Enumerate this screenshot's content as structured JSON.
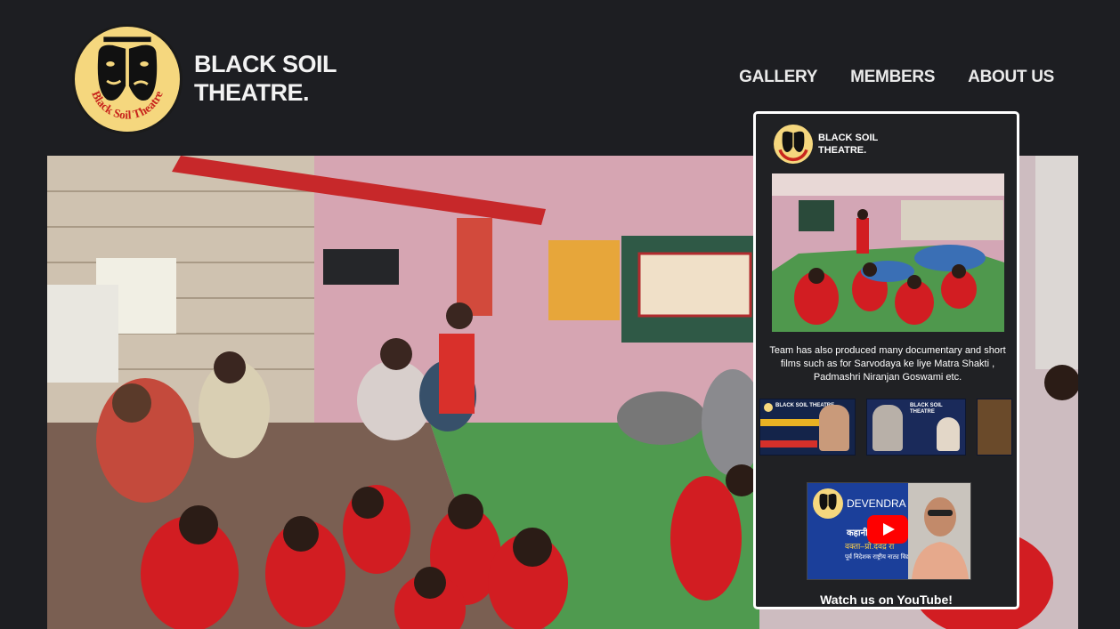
{
  "brand": {
    "line1": "BLACK SOIL",
    "line2": "THEATRE.",
    "logo_ring_text": "Black Soil Theatre"
  },
  "nav": {
    "items": [
      "GALLERY",
      "MEMBERS",
      "ABOUT US"
    ]
  },
  "hero": {
    "image_icon": "classroom-photo"
  },
  "card": {
    "brand_line1": "BLACK SOIL",
    "brand_line2": "THEATRE.",
    "description": "Team has also produced many documentary and short films such as for Sarvodaya ke liye Matra Shakti , Padmashri Niranjan Goswami etc.",
    "video": {
      "title": "DEVENDRA RA...",
      "line1": "कहानी का रंग",
      "line2": "वक्ता–प्रो.देवेंद्र रा",
      "line3": "पूर्व निदेशक राष्ट्रीय नाट्य विद्यालय, नई दिल्ली"
    },
    "thumbs": [
      {
        "label": "BLACK SOIL THEATRE"
      },
      {
        "label": "BLACK SOIL THEATRE"
      }
    ],
    "watch_label": "Watch us on YouTube!"
  },
  "colors": {
    "background": "#1d1e22",
    "logo_yellow": "#f5d77e",
    "logo_red": "#c8251d",
    "youtube_red": "#ff0000"
  }
}
